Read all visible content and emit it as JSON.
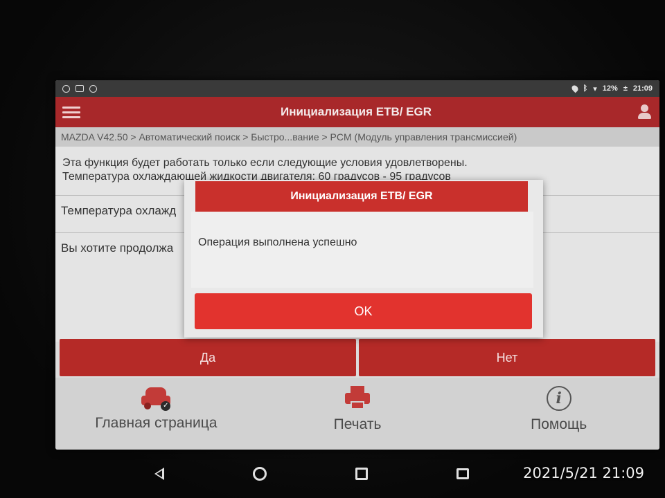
{
  "status_bar": {
    "battery": "12%",
    "time": "21:09"
  },
  "app_bar": {
    "title": "Инициализация ETB/ EGR"
  },
  "breadcrumb": "MAZDA V42.50 > Автоматический поиск > Быстро...вание > PCM (Модуль управления трансмиссией)",
  "content": {
    "info_line1": "Эта функция будет работать только если следующие условия удовлетворены.",
    "info_line2": "Температура охлаждающей жидкости двигателя: 60 градусов - 95 градусов",
    "row1": "Температура охлажд",
    "row2": "Вы хотите продолжа"
  },
  "buttons": {
    "yes": "Да",
    "no": "Нет"
  },
  "bottom_nav": {
    "home": "Главная страница",
    "print": "Печать",
    "help": "Помощь"
  },
  "dialog": {
    "title": "Инициализация ETB/ EGR",
    "message": "Операция выполнена успешно",
    "ok": "OK"
  },
  "timestamp": "2021/5/21 21:09",
  "colors": {
    "app_bar": "#a8282a",
    "dialog_header": "#c9302c",
    "ok_button": "#e2332e",
    "action_button": "#b52a27"
  },
  "icons": {
    "menu": "hamburger-icon",
    "user": "user-icon",
    "home": "car-icon",
    "print": "printer-icon",
    "help": "info-icon"
  }
}
